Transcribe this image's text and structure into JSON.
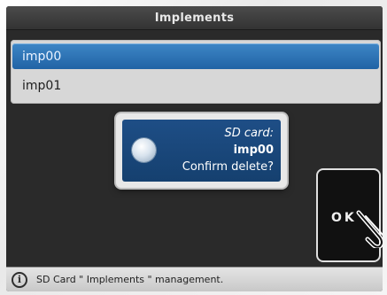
{
  "header": {
    "title": "Implements"
  },
  "list": {
    "items": [
      {
        "label": "imp00",
        "selected": true
      },
      {
        "label": "imp01",
        "selected": false
      }
    ]
  },
  "dialog": {
    "title": "SD card:",
    "name": "imp00",
    "question": "Confirm delete?",
    "icon": "globe-icon"
  },
  "ok_button": {
    "label": "OK",
    "icon": "hand-pointer-icon"
  },
  "status": {
    "icon": "info-icon",
    "text": "SD Card \" Implements \" management."
  },
  "colors": {
    "selected_row": "#2f74b8",
    "dialog_bg": "#1a4a7e",
    "title_bar": "#3c3c3c"
  }
}
